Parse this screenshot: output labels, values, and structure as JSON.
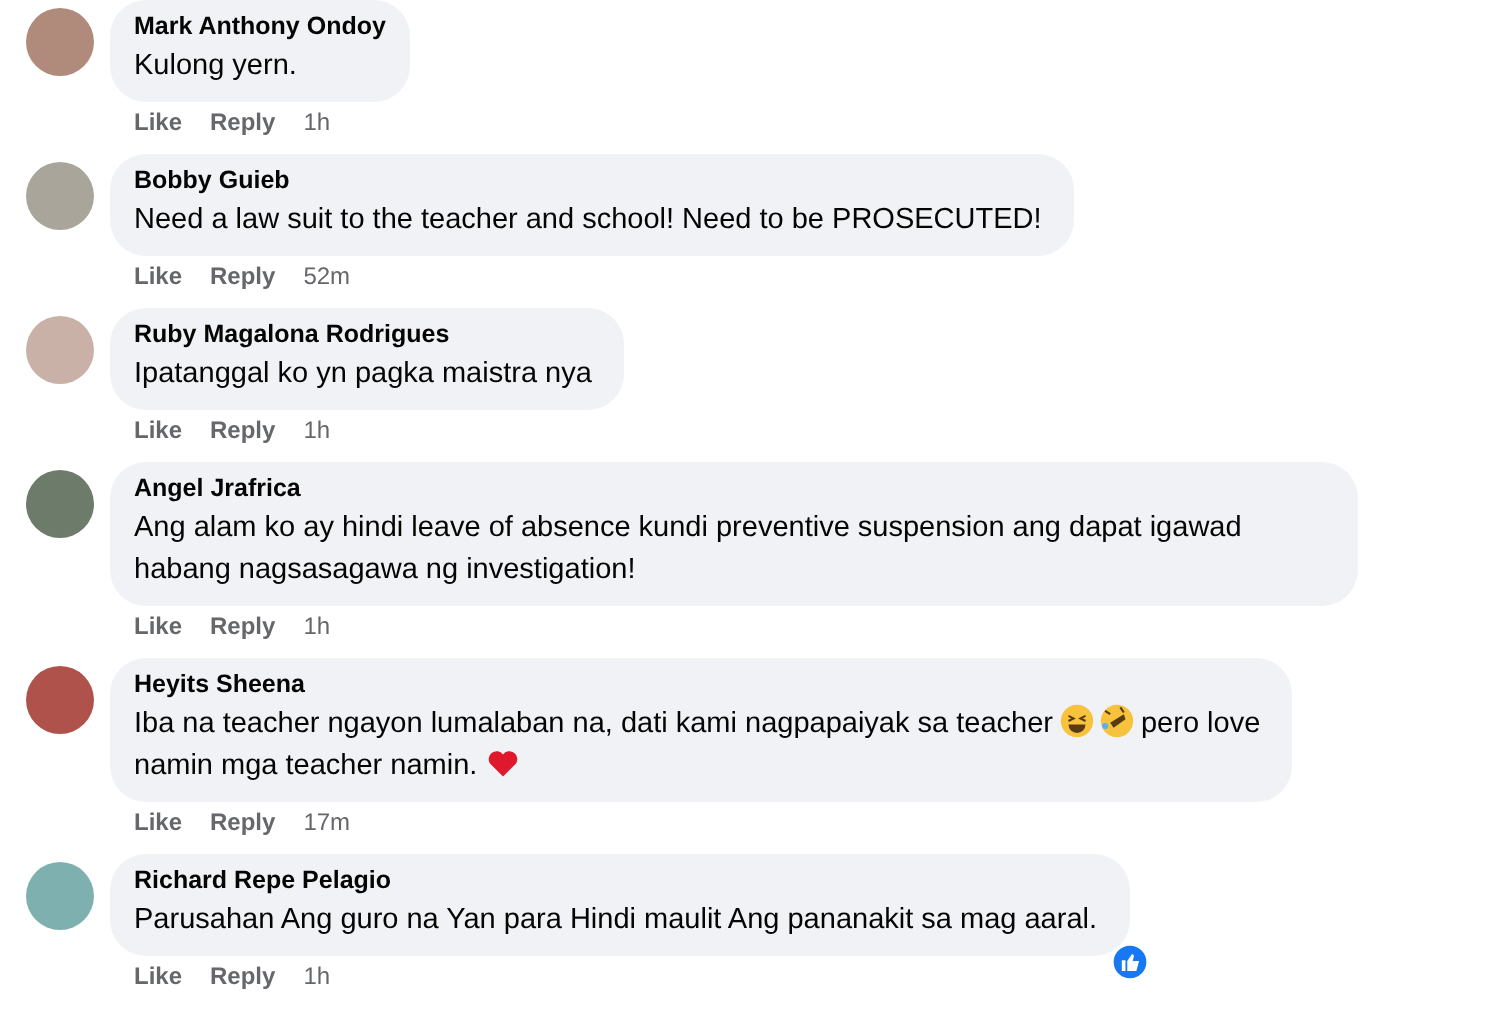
{
  "comments": [
    {
      "author": "Mark Anthony Ondoy",
      "body": [
        {
          "kind": "text",
          "text": "Kulong yern."
        }
      ],
      "actions": [
        "Like",
        "Reply"
      ],
      "time": "1h"
    },
    {
      "author": "Bobby Guieb",
      "body": [
        {
          "kind": "text",
          "text": "Need a law suit to the teacher and school! Need to be PROSECUTED!"
        }
      ],
      "actions": [
        "Like",
        "Reply"
      ],
      "time": "52m"
    },
    {
      "author": "Ruby Magalona Rodrigues",
      "body": [
        {
          "kind": "text",
          "text": "Ipatanggal ko yn pagka maistra nya"
        }
      ],
      "actions": [
        "Like",
        "Reply"
      ],
      "time": "1h"
    },
    {
      "author": "Angel Jrafrica",
      "body": [
        {
          "kind": "text",
          "text": "Ang alam ko ay hindi leave of absence kundi preventive suspension ang dapat igawad habang nagsasagawa ng investigation!"
        }
      ],
      "actions": [
        "Like",
        "Reply"
      ],
      "time": "1h"
    },
    {
      "author": "Heyits Sheena",
      "body": [
        {
          "kind": "text",
          "text": "Iba na teacher ngayon lumalaban na, dati kami nagpapaiyak sa teacher"
        },
        {
          "kind": "grin"
        },
        {
          "kind": "rofl"
        },
        {
          "kind": "text",
          "text": "pero love"
        },
        {
          "kind": "break"
        },
        {
          "kind": "text",
          "text": "namin mga teacher namin."
        },
        {
          "kind": "heart"
        }
      ],
      "actions": [
        "Like",
        "Reply"
      ],
      "time": "17m"
    },
    {
      "author": "Richard Repe Pelagio",
      "body": [
        {
          "kind": "text",
          "text": "Parusahan Ang guro na Yan para Hindi maulit Ang pananakit sa mag aaral."
        }
      ],
      "actions": [
        "Like",
        "Reply"
      ],
      "time": "1h",
      "liked": true
    }
  ]
}
